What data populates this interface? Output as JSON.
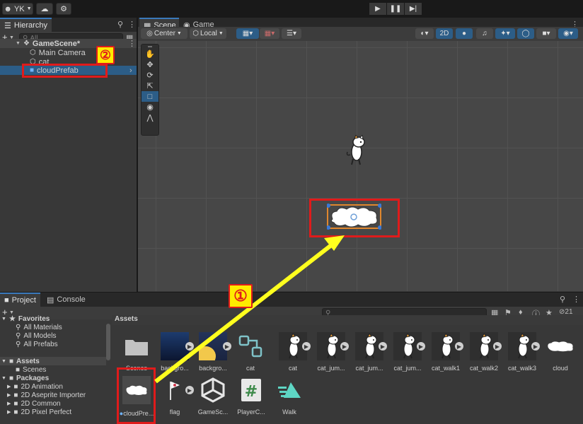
{
  "toolbar": {
    "account": "YK",
    "account_icon": "account-icon",
    "cloud_icon": "cloud-icon",
    "settings_icon": "gear-icon",
    "play_icon": "play-icon",
    "pause_icon": "pause-icon",
    "step_icon": "step-icon"
  },
  "hierarchy": {
    "tab_label": "Hierarchy",
    "search_placeholder": "All",
    "items": [
      {
        "label": "GameScene*",
        "icon": "unity-scene-icon"
      },
      {
        "label": "Main Camera",
        "icon": "gameobject-icon"
      },
      {
        "label": "cat",
        "icon": "gameobject-icon"
      },
      {
        "label": "cloudPrefab",
        "icon": "prefab-cube-icon",
        "selected": true
      }
    ]
  },
  "scene": {
    "tabs": [
      {
        "label": "Scene",
        "icon": "scene-grid-icon",
        "active": true
      },
      {
        "label": "Game",
        "icon": "game-controller-icon",
        "active": false
      }
    ],
    "pivot_label": "Center",
    "space_label": "Local",
    "mode_2d_label": "2D",
    "tools": [
      "hand-tool-icon",
      "move-tool-icon",
      "rotate-tool-icon",
      "scale-tool-icon",
      "rect-tool-icon",
      "transform-tool-icon",
      "custom-tool-icon"
    ]
  },
  "project": {
    "tabs": [
      {
        "label": "Project",
        "icon": "folder-icon",
        "active": true
      },
      {
        "label": "Console",
        "icon": "console-icon",
        "active": false
      }
    ],
    "count_label": "21",
    "favorites": {
      "header": "Favorites",
      "items": [
        "All Materials",
        "All Models",
        "All Prefabs"
      ]
    },
    "assets_header": "Assets",
    "scenes_label": "Scenes",
    "packages": {
      "header": "Packages",
      "items": [
        "2D Animation",
        "2D Aseprite Importer",
        "2D Common",
        "2D Pixel Perfect"
      ]
    },
    "breadcrumb": "Assets",
    "assets_row1": [
      {
        "label": "Scenes",
        "kind": "folder"
      },
      {
        "label": "backgro...",
        "kind": "background"
      },
      {
        "label": "backgro...",
        "kind": "background-hill"
      },
      {
        "label": "cat",
        "kind": "prefab-node"
      },
      {
        "label": "cat",
        "kind": "cat-sprite"
      },
      {
        "label": "cat_jum...",
        "kind": "cat-sprite"
      },
      {
        "label": "cat_jum...",
        "kind": "cat-sprite"
      },
      {
        "label": "cat_jum...",
        "kind": "cat-sprite"
      },
      {
        "label": "cat_walk1",
        "kind": "cat-sprite"
      },
      {
        "label": "cat_walk2",
        "kind": "cat-sprite"
      },
      {
        "label": "cat_walk3",
        "kind": "cat-sprite"
      },
      {
        "label": "cloud",
        "kind": "cloud-sprite"
      }
    ],
    "assets_row2": [
      {
        "label": "cloudPre...",
        "kind": "cloud-prefab"
      },
      {
        "label": "flag",
        "kind": "flag"
      },
      {
        "label": "GameSc...",
        "kind": "unity-scene"
      },
      {
        "label": "PlayerC...",
        "kind": "csharp-script"
      },
      {
        "label": "Walk",
        "kind": "animation"
      }
    ]
  },
  "annotations": {
    "step1": "①",
    "step2": "②",
    "highlight_color": "#e01b1b",
    "arrow_color": "#ffff1e"
  }
}
